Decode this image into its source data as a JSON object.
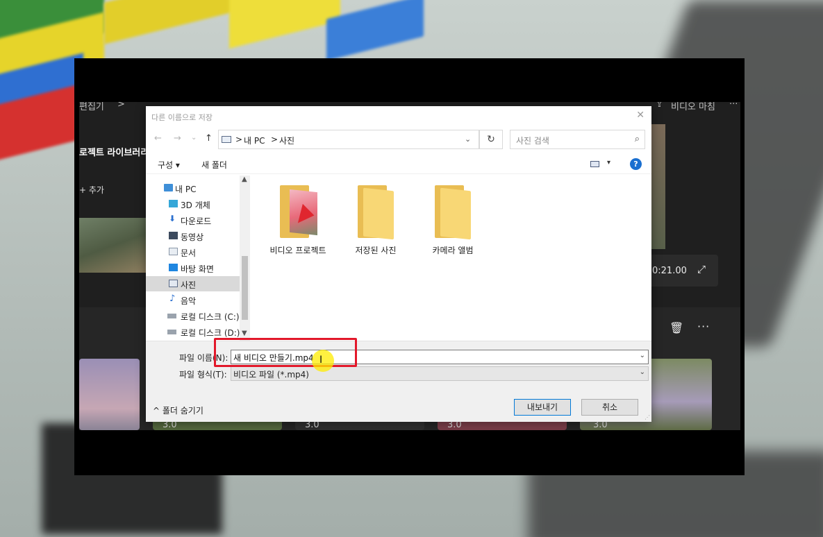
{
  "app": {
    "breadcrumb_root": "편집기",
    "breadcrumb_sep": ">",
    "project_library": "로젝트 라이브러리",
    "add_label": "+ 추가",
    "export_label": "비디오 마침",
    "overflow": "···",
    "timecode": "0:21.00",
    "clip_durations": [
      "3.0",
      "3.0",
      "3.0",
      "3.0"
    ]
  },
  "dialog": {
    "title": "다른 이름으로 저장",
    "close_glyph": "✕",
    "nav": {
      "back": "←",
      "forward": "→",
      "recent": "⌄",
      "up": "↑"
    },
    "address": {
      "crumbs": [
        "내 PC",
        "사진"
      ],
      "sep": ">"
    },
    "refresh_glyph": "↻",
    "search_placeholder": "사진 검색",
    "toolbar": {
      "organize": "구성 ▾",
      "new_folder": "새 폴더",
      "help": "?"
    },
    "tree": [
      {
        "label": "내 PC",
        "icon": "pc-icon",
        "selected": false
      },
      {
        "label": "3D 개체",
        "icon": "3d-objects-icon",
        "selected": false
      },
      {
        "label": "다운로드",
        "icon": "download-icon",
        "selected": false
      },
      {
        "label": "동영상",
        "icon": "videos-icon",
        "selected": false
      },
      {
        "label": "문서",
        "icon": "documents-icon",
        "selected": false
      },
      {
        "label": "바탕 화면",
        "icon": "desktop-icon",
        "selected": false
      },
      {
        "label": "사진",
        "icon": "pictures-icon",
        "selected": true
      },
      {
        "label": "음악",
        "icon": "music-icon",
        "selected": false
      },
      {
        "label": "로컬 디스크 (C:)",
        "icon": "drive-icon",
        "selected": false
      },
      {
        "label": "로컬 디스크 (D:)",
        "icon": "drive-icon",
        "selected": false
      }
    ],
    "folders": [
      {
        "name": "비디오 프로젝트"
      },
      {
        "name": "저장된 사진"
      },
      {
        "name": "카메라 앨범"
      }
    ],
    "filename_label": "파일 이름(N):",
    "filename_value": "새 비디오 만들기.mp4",
    "filetype_label": "파일 형식(T):",
    "filetype_value": "비디오 파일 (*.mp4)",
    "hide_folders": "^ 폴더 숨기기",
    "export_button": "내보내기",
    "cancel_button": "취소"
  },
  "colors": {
    "highlight_box": "#e2182a",
    "cursor_highlight": "#ffec00",
    "help_blue": "#1a6fd0"
  }
}
